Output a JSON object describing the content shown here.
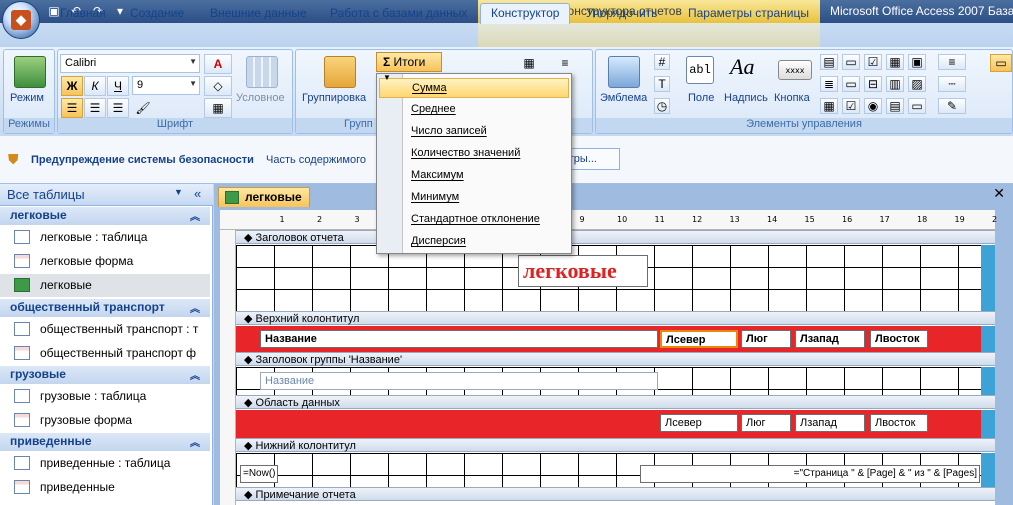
{
  "qat": {
    "items": [
      "save-icon",
      "undo-icon",
      "redo-icon",
      "customize-icon"
    ]
  },
  "titlebar": {
    "context_title": "Инструменты конструктора отчетов",
    "app_title": "Microsoft Office Access 2007 База да"
  },
  "tabs": [
    "Главная",
    "Создание",
    "Внешние данные",
    "Работа с базами данных",
    "Конструктор",
    "Упорядочить",
    "Параметры страницы"
  ],
  "active_tab": "Конструктор",
  "ribbon": {
    "groups": {
      "modes": "Режимы",
      "font": "Шрифт",
      "grouping": "Групп",
      "controls": "Элементы управления"
    },
    "mode_button": "Режим",
    "font_name": "Calibri",
    "font_size": "9",
    "bold": "Ж",
    "italic": "К",
    "underline": "Ч",
    "conditional": "Условное",
    "grouping_button": "Группировка",
    "totals_button": "Итоги",
    "sigma": "Σ",
    "logo_button": "Эмблема",
    "field_button": "Поле",
    "label_button": "Надпись",
    "button_button": "Кнопка",
    "field_glyph": "abl",
    "label_glyph": "Aa",
    "button_glyph": "xxxx"
  },
  "security": {
    "label": "Предупреждение системы безопасности",
    "text": "Часть содержимого",
    "options_button": "етры..."
  },
  "nav": {
    "header": "Все таблицы",
    "groups": [
      {
        "name": "легковые",
        "items": [
          {
            "label": "легковые : таблица",
            "type": "table"
          },
          {
            "label": "легковые форма",
            "type": "form"
          },
          {
            "label": "легковые",
            "type": "report",
            "selected": true
          }
        ]
      },
      {
        "name": "общественный транспорт",
        "items": [
          {
            "label": "общественный транспорт : т",
            "type": "table"
          },
          {
            "label": "общественный транспорт ф",
            "type": "form"
          }
        ]
      },
      {
        "name": "грузовые",
        "items": [
          {
            "label": "грузовые : таблица",
            "type": "table"
          },
          {
            "label": "грузовые форма",
            "type": "form"
          }
        ]
      },
      {
        "name": "приведенные",
        "items": [
          {
            "label": "приведенные : таблица",
            "type": "table"
          },
          {
            "label": "приведенные",
            "type": "form"
          }
        ]
      }
    ]
  },
  "document": {
    "tab_label": "легковые",
    "ruler_marks": [
      "1",
      "2",
      "3",
      "4",
      "5",
      "6",
      "7",
      "8",
      "9",
      "10",
      "11",
      "12",
      "13",
      "14",
      "15",
      "16",
      "17",
      "18",
      "19",
      "2"
    ],
    "sections": [
      "Заголовок отчета",
      "Верхний колонтитул",
      "Заголовок группы 'Название'",
      "Область данных",
      "Нижний колонтитул",
      "Примечание отчета"
    ],
    "report_title": "легковые",
    "header_fields": [
      "Название",
      "Лсевер",
      "Люг",
      "Лзапад",
      "Лвосток"
    ],
    "group_field": "Название",
    "data_fields": [
      "Лсевер",
      "Люг",
      "Лзапад",
      "Лвосток"
    ],
    "footer_left": "=Now()",
    "footer_right": "=\"Страница \" & [Page] & \" из \" & [Pages]"
  },
  "totals_menu": {
    "items": [
      "Сумма",
      "Среднее",
      "Число записей",
      "Количество значений",
      "Максимум",
      "Минимум",
      "Стандартное отклонение",
      "Дисперсия"
    ],
    "highlighted": "Сумма"
  }
}
